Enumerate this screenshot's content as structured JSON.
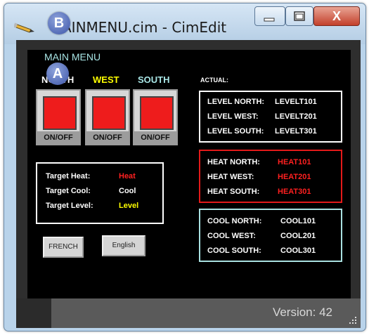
{
  "window": {
    "title": "AINMENU.cim - CimEdit",
    "icon": "pencil-icon",
    "minimize_icon": "minimize-icon",
    "maximize_icon": "maximize-icon",
    "close_label": "X"
  },
  "badges": {
    "b": "B",
    "a": "A"
  },
  "screen": {
    "heading": "MAIN MENU",
    "zones": [
      {
        "label": "NORTH",
        "color": "#ffffff",
        "switch_label": "ON/OFF"
      },
      {
        "label": "WEST",
        "color": "#ffff00",
        "switch_label": "ON/OFF"
      },
      {
        "label": "SOUTH",
        "color": "#a9e6e6",
        "switch_label": "ON/OFF"
      }
    ],
    "targets": [
      {
        "label": "Target Heat:",
        "value": "Heat",
        "value_color": "#ff2020"
      },
      {
        "label": "Target Cool:",
        "value": "Cool",
        "value_color": "#ffffff"
      },
      {
        "label": "Target Level:",
        "value": "Level",
        "value_color": "#ffff00"
      }
    ],
    "buttons": {
      "french": "FRENCH",
      "english": "English"
    },
    "actual_label": "ACTUAL:",
    "level_panel": [
      {
        "label": "LEVEL NORTH:",
        "value": "LEVELT101"
      },
      {
        "label": "LEVEL WEST:",
        "value": "LEVELT201"
      },
      {
        "label": "LEVEL SOUTH:",
        "value": "LEVELT301"
      }
    ],
    "heat_panel": [
      {
        "label": "HEAT NORTH:",
        "value": "HEAT101"
      },
      {
        "label": "HEAT WEST:",
        "value": "HEAT201"
      },
      {
        "label": "HEAT SOUTH:",
        "value": "HEAT301"
      }
    ],
    "cool_panel": [
      {
        "label": "COOL NORTH:",
        "value": "COOL101"
      },
      {
        "label": "COOL WEST:",
        "value": "COOL201"
      },
      {
        "label": "COOL SOUTH:",
        "value": "COOL301"
      }
    ],
    "colors": {
      "heat_border": "#e31a1a",
      "heat_value": "#ff2020",
      "cool_border": "#a9e0e0",
      "level_border": "#ffffff"
    }
  },
  "status": {
    "version": "Version: 42"
  }
}
